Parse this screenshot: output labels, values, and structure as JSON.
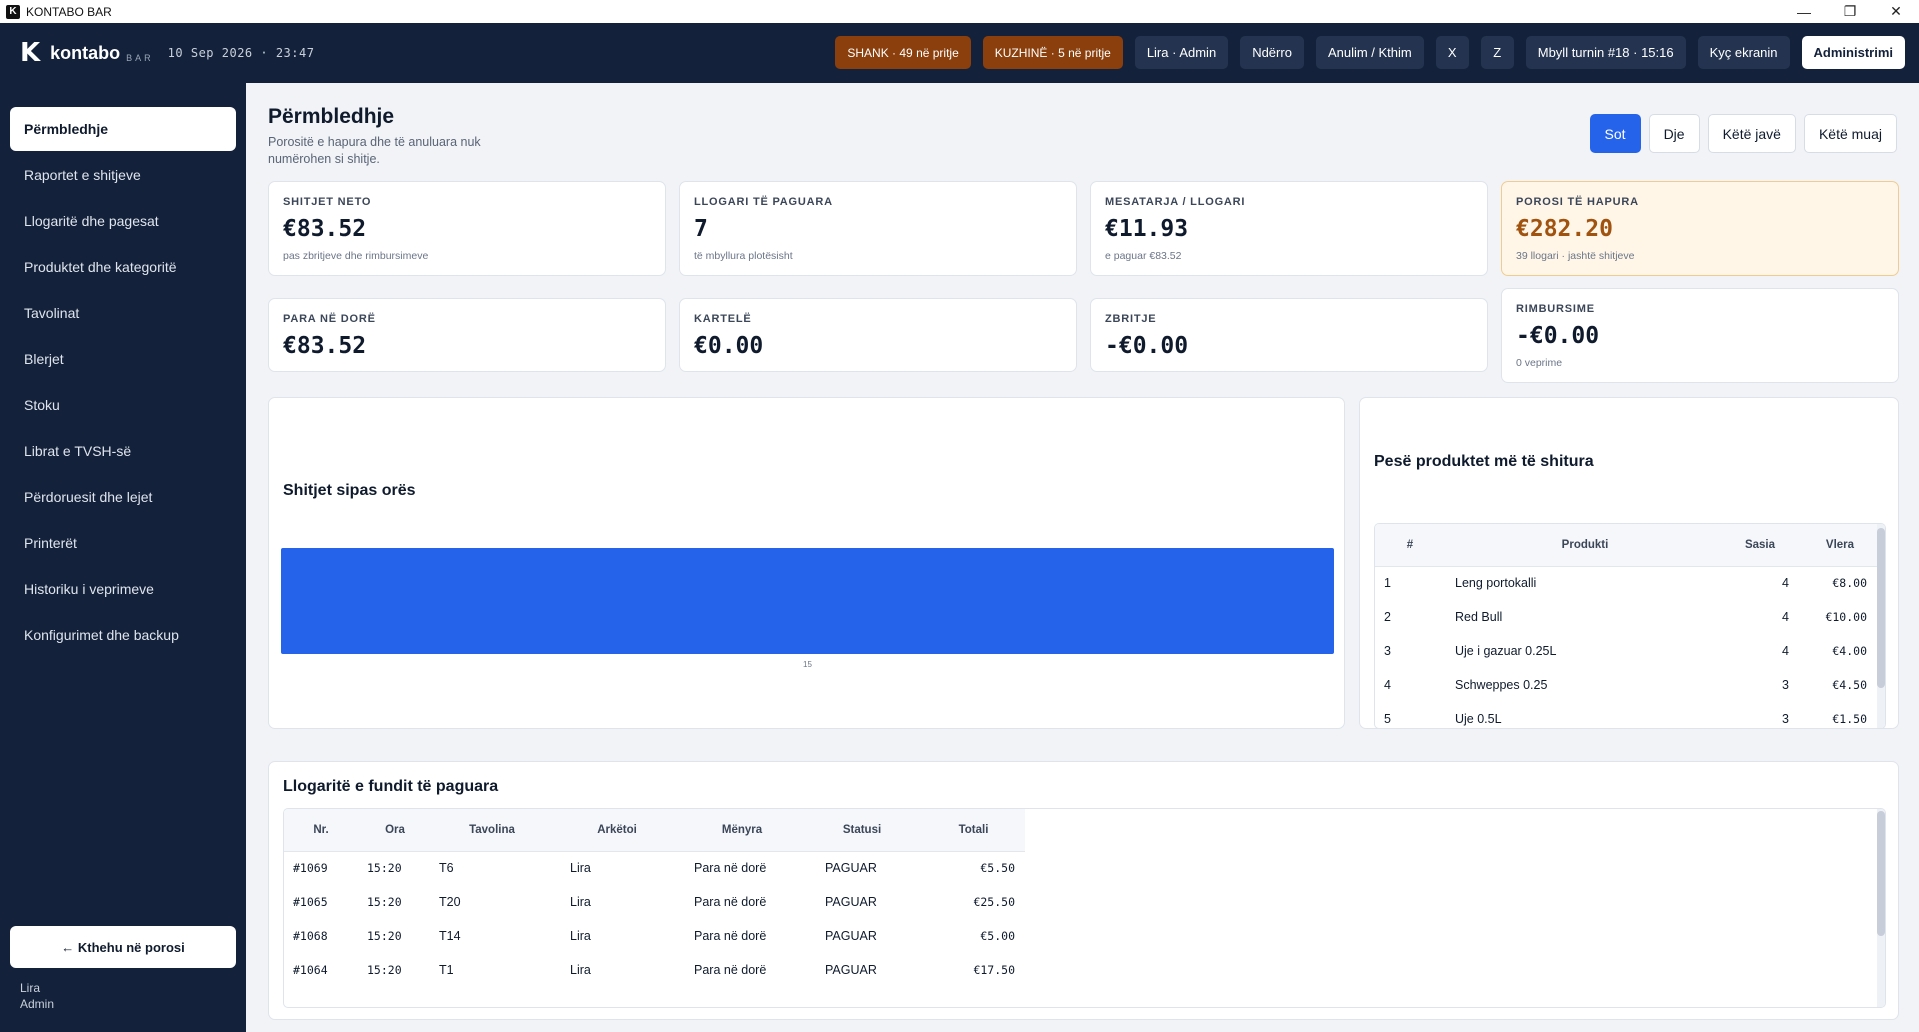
{
  "window": {
    "title": "KONTABO BAR",
    "app_icon": "K",
    "controls": {
      "minimize": "—",
      "maximize": "❐",
      "close": "✕"
    }
  },
  "header": {
    "logo_mark": "K",
    "brand": "kontabo",
    "brand_sub": "BAR",
    "datetime": "10 Sep 2026 · 23:47",
    "actions": {
      "shank": "SHANK · 49 në pritje",
      "kuzhine": "KUZHINË · 5 në pritje",
      "user": "Lira · Admin",
      "switch": "Ndërro",
      "cancel": "Anulim / Kthim",
      "x": "X",
      "z": "Z",
      "close_shift": "Mbyll turnin #18 · 15:16",
      "lock": "Kyç ekranin",
      "admin": "Administrimi"
    }
  },
  "sidebar": {
    "items": [
      {
        "label": "Përmbledhje"
      },
      {
        "label": "Raportet e shitjeve"
      },
      {
        "label": "Llogaritë dhe pagesat"
      },
      {
        "label": "Produktet dhe kategoritë"
      },
      {
        "label": "Tavolinat"
      },
      {
        "label": "Blerjet"
      },
      {
        "label": "Stoku"
      },
      {
        "label": "Librat e TVSH-së"
      },
      {
        "label": "Përdoruesit dhe lejet"
      },
      {
        "label": "Printerët"
      },
      {
        "label": "Historiku i veprimeve"
      },
      {
        "label": "Konfigurimet dhe backup"
      }
    ],
    "back_button": "← Kthehu në porosi",
    "user_name": "Lira",
    "user_role": "Admin"
  },
  "page": {
    "title": "Përmbledhje",
    "subtitle": "Porositë e hapura dhe të anuluara nuk numërohen si shitje.",
    "periods": [
      "Sot",
      "Dje",
      "Këtë javë",
      "Këtë muaj"
    ],
    "active_period": "Sot"
  },
  "stats": {
    "net_sales": {
      "label": "SHITJET NETO",
      "value": "€83.52",
      "note": "pas zbritjeve dhe rimbursimeve"
    },
    "paid_bills": {
      "label": "LLOGARI TË PAGUARA",
      "value": "7",
      "note": "të mbyllura plotësisht"
    },
    "average": {
      "label": "MESATARJA / LLOGARI",
      "value": "€11.93",
      "note": "e paguar €83.52"
    },
    "open_orders": {
      "label": "POROSI TË HAPURA",
      "value": "€282.20",
      "note": "39 llogari · jashtë shitjeve"
    },
    "cash": {
      "label": "PARA NË DORË",
      "value": "€83.52"
    },
    "cards": {
      "label": "KARTELË",
      "value": "€0.00"
    },
    "discounts": {
      "label": "ZBRITJE",
      "value": "-€0.00"
    },
    "refunds": {
      "label": "RIMBURSIME",
      "value": "-€0.00",
      "note": "0 veprime"
    }
  },
  "sales_by_hour": {
    "title": "Shitjet sipas orës",
    "bar_color": "#2563eb"
  },
  "chart_data": {
    "type": "bar",
    "categories": [
      "15"
    ],
    "values": [
      83.52
    ],
    "title": "Shitjet sipas orës",
    "xlabel": "",
    "ylabel": ""
  },
  "top_products": {
    "title": "Pesë produktet më të shitura",
    "columns": [
      "#",
      "Produkti",
      "Sasia",
      "Vlera"
    ],
    "rows": [
      {
        "rank": "1",
        "name": "Leng portokalli",
        "qty": "4",
        "value": "€8.00"
      },
      {
        "rank": "2",
        "name": "Red Bull",
        "qty": "4",
        "value": "€10.00"
      },
      {
        "rank": "3",
        "name": "Uje i gazuar 0.25L",
        "qty": "4",
        "value": "€4.00"
      },
      {
        "rank": "4",
        "name": "Schweppes 0.25",
        "qty": "3",
        "value": "€4.50"
      },
      {
        "rank": "5",
        "name": "Uje 0.5L",
        "qty": "3",
        "value": "€1.50"
      }
    ]
  },
  "recent_bills": {
    "title": "Llogaritë e fundit të paguara",
    "columns": [
      "Nr.",
      "Ora",
      "Tavolina",
      "Arkëtoi",
      "Mënyra",
      "Statusi",
      "Totali"
    ],
    "rows": [
      {
        "nr": "#1069",
        "time": "15:20",
        "table": "T6",
        "cashier": "Lira",
        "method": "Para në dorë",
        "status": "PAGUAR",
        "total": "€5.50"
      },
      {
        "nr": "#1065",
        "time": "15:20",
        "table": "T20",
        "cashier": "Lira",
        "method": "Para në dorë",
        "status": "PAGUAR",
        "total": "€25.50"
      },
      {
        "nr": "#1068",
        "time": "15:20",
        "table": "T14",
        "cashier": "Lira",
        "method": "Para në dorë",
        "status": "PAGUAR",
        "total": "€5.00"
      },
      {
        "nr": "#1064",
        "time": "15:20",
        "table": "T1",
        "cashier": "Lira",
        "method": "Para në dorë",
        "status": "PAGUAR",
        "total": "€17.50"
      }
    ]
  }
}
